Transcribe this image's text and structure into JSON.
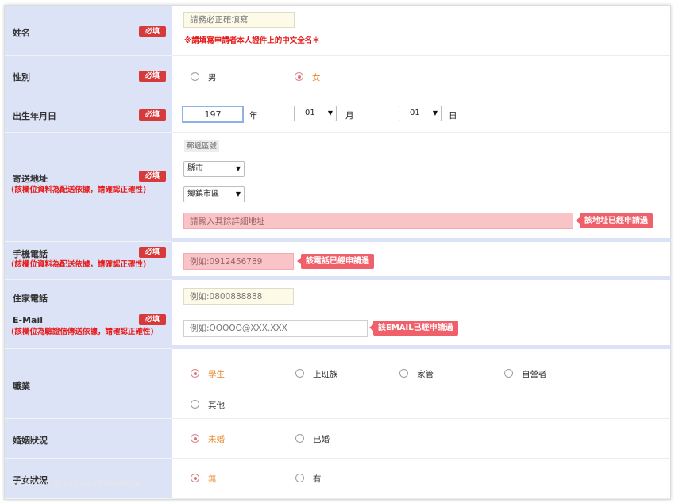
{
  "required_badge": "必填",
  "name": {
    "label": "姓名",
    "placeholder": "請務必正確填寫",
    "hint": "※請填寫申請者本人證件上的中文全名＊"
  },
  "gender": {
    "label": "性別",
    "options": [
      {
        "label": "男",
        "checked": false
      },
      {
        "label": "女",
        "checked": true
      }
    ]
  },
  "birthday": {
    "label": "出生年月日",
    "year_value": "197",
    "year_unit": "年",
    "month_value": "01",
    "month_unit": "月",
    "day_value": "01",
    "day_unit": "日"
  },
  "address": {
    "label": "寄送地址",
    "note": "(該欄位資料為配送依據，請確認正確性)",
    "zip_label": "郵遞區號",
    "county_value": "縣市",
    "district_value": "鄉鎮市區",
    "detail_placeholder": "請輸入其餘詳細地址",
    "error_tag": "該地址已經申請過"
  },
  "mobile": {
    "label": "手機電話",
    "note": "(該欄位資料為配送依據，請確認正確性)",
    "placeholder": "例如:0912456789",
    "error_tag": "該電話已經申請過"
  },
  "home_phone": {
    "label": "住家電話",
    "placeholder": "例如:0800888888"
  },
  "email": {
    "label": "E-Mail",
    "note": "(該欄位為驗證信傳送依據，請確認正確性)",
    "placeholder": "例如:OOOOO@XXX.XXX",
    "error_tag": "該EMAIL已經申請過"
  },
  "occupation": {
    "label": "職業",
    "options": [
      {
        "label": "學生",
        "checked": true
      },
      {
        "label": "上班族",
        "checked": false
      },
      {
        "label": "家管",
        "checked": false
      },
      {
        "label": "自營者",
        "checked": false
      },
      {
        "label": "其他",
        "checked": false
      }
    ]
  },
  "marital": {
    "label": "婚姻狀況",
    "options": [
      {
        "label": "未婚",
        "checked": true
      },
      {
        "label": "已婚",
        "checked": false
      }
    ]
  },
  "children": {
    "label": "子女狀況",
    "options": [
      {
        "label": "無",
        "checked": true
      },
      {
        "label": "有",
        "checked": false
      }
    ]
  },
  "watermark": "Screenshot @ Yuniman-NiMarAll.tw",
  "colors": {
    "label_bg": "#dde3f6",
    "required_bg": "#d63a3a",
    "error_tag_bg": "#f0606a",
    "warning_text": "#e61b1b",
    "checked_text": "#e88a2a"
  }
}
